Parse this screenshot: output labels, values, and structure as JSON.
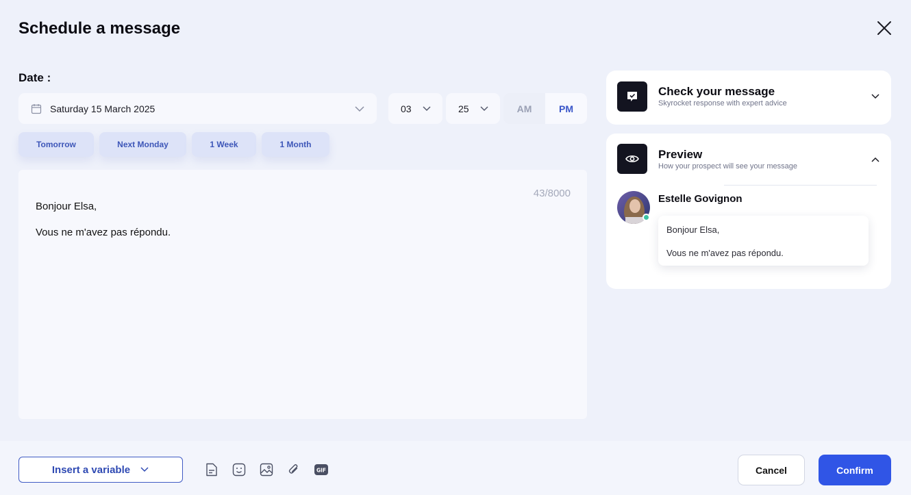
{
  "modal": {
    "title": "Schedule a message"
  },
  "date": {
    "label": "Date :",
    "value": "Saturday 15 March 2025",
    "hour": "03",
    "minute": "25",
    "am_label": "AM",
    "pm_label": "PM",
    "selected_period": "PM"
  },
  "quick_dates": [
    {
      "label": "Tomorrow"
    },
    {
      "label": "Next Monday"
    },
    {
      "label": "1 Week"
    },
    {
      "label": "1 Month"
    }
  ],
  "editor": {
    "counter": "43/8000",
    "lines": [
      "Bonjour Elsa,",
      "Vous ne m'avez pas répondu."
    ]
  },
  "check_card": {
    "title": "Check your message",
    "subtitle": "Skyrocket response with expert advice",
    "icon": "message-check-icon",
    "expanded": false
  },
  "preview_card": {
    "title": "Preview",
    "subtitle": "How your prospect will see your message",
    "icon": "eye-icon",
    "expanded": true,
    "sender_name": "Estelle Govignon",
    "online": true,
    "bubble_lines": [
      "Bonjour Elsa,",
      "Vous ne m'avez pas répondu."
    ]
  },
  "footer": {
    "insert_variable_label": "Insert a variable",
    "tools": [
      "template-icon",
      "emoji-icon",
      "image-icon",
      "attachment-icon",
      "gif-icon"
    ],
    "cancel_label": "Cancel",
    "confirm_label": "Confirm"
  },
  "colors": {
    "accent": "#3055e6",
    "background": "#eef1fa",
    "quick_button": "#dde3f8",
    "online": "#3dc2a2"
  }
}
